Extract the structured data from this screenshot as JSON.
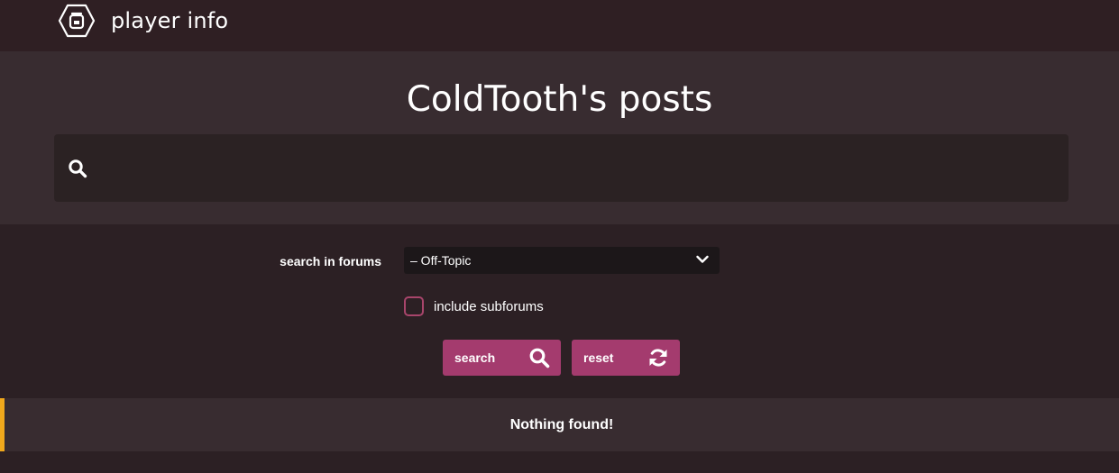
{
  "topbar": {
    "title": "player info",
    "logo_icon": "hexagon-bot-logo-icon"
  },
  "hero": {
    "title": "ColdTooth's posts",
    "search": {
      "value": "",
      "placeholder": "",
      "icon": "search-icon"
    }
  },
  "filters": {
    "forum_label": "search in forums",
    "forum_selected": "– Off-Topic",
    "forum_chevron_icon": "chevron-down-icon",
    "include_subforums_label": "include subforums",
    "include_subforums_checked": false
  },
  "actions": {
    "search_label": "search",
    "search_icon": "search-icon",
    "reset_label": "reset",
    "reset_icon": "refresh-icon"
  },
  "result": {
    "message": "Nothing found!"
  },
  "colors": {
    "topbar_bg": "#2f1f23",
    "hero_bg": "#382c30",
    "page_bg": "#2c2024",
    "button_accent": "#a43b6e",
    "checkbox_border": "#a8456b",
    "notice_accent": "#f0a81c"
  }
}
